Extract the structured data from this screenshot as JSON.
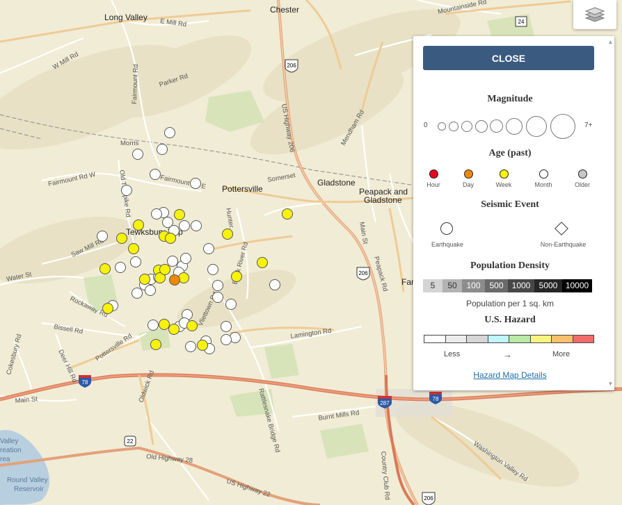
{
  "map": {
    "places": [
      {
        "name": "Long Valley",
        "big": true
      },
      {
        "name": "Chester",
        "big": true
      },
      {
        "name": "Pottersville",
        "big": true
      },
      {
        "name": "Gladstone",
        "big": true
      },
      {
        "name": "Peapack and",
        "big": true
      },
      {
        "name": "Gladstone",
        "big": true
      },
      {
        "name": "Tewksbury Twp",
        "big": true
      },
      {
        "name": "Far",
        "big": true
      }
    ],
    "roads": [
      "E Mill Rd",
      "W Mill Rd",
      "Parker Rd",
      "Fairmount Rd",
      "Fairmount Rd W",
      "Fairmount Rd E",
      "Old Turnpike Rd",
      "Saw Mill Rd",
      "Water St",
      "Rockaway Rd",
      "Bissell Rd",
      "Cokesbury Rd",
      "Deer Hill Rd",
      "Main St",
      "Pottersville Rd",
      "Lamington Rd",
      "Rattlesnake Bridge Rd",
      "Oldwick Rd",
      "Burnt Mills Rd",
      "Old Highway 28",
      "US Highway 22",
      "US Highway 206",
      "Mendham Rd",
      "Main St",
      "Peapack Rd",
      "Washington Valley Rd",
      "Country Club Rd",
      "Mountainside Rd",
      "Black River Rd",
      "Vliettown Rd",
      "Somerset",
      "Morris",
      "Hunter..."
    ],
    "shields": [
      "206",
      "206",
      "24",
      "78",
      "78",
      "287",
      "22",
      "206"
    ],
    "water": [
      "Valley",
      "reation",
      "rea",
      "Round Valley",
      "Reservoir"
    ]
  },
  "legend": {
    "close_label": "CLOSE",
    "magnitude": {
      "title": "Magnitude",
      "min_label": "0",
      "max_label": "7+"
    },
    "age": {
      "title": "Age (past)",
      "items": [
        {
          "label": "Hour",
          "color": "#e8001c"
        },
        {
          "label": "Day",
          "color": "#ee8a00"
        },
        {
          "label": "Week",
          "color": "#f7f20a"
        },
        {
          "label": "Month",
          "color": "#ffffff"
        },
        {
          "label": "Older",
          "color": "#c6c6c6"
        }
      ]
    },
    "seismic": {
      "title": "Seismic Event",
      "earthquake": "Earthquake",
      "non_earthquake": "Non-Earthquake"
    },
    "population": {
      "title": "Population Density",
      "values": [
        "5",
        "50",
        "100",
        "500",
        "1000",
        "5000",
        "10000"
      ],
      "caption": "Population per 1 sq. km"
    },
    "hazard": {
      "title": "U.S. Hazard",
      "colors": [
        "#ffffff",
        "#ececec",
        "#d6d6d6",
        "#bff5fb",
        "#b9e9a2",
        "#f8f57f",
        "#f7c06a",
        "#f26a6a"
      ],
      "less": "Less",
      "arrow": "→",
      "more": "More",
      "link": "Hazard Map Details"
    }
  },
  "earthquakes": [
    {
      "age": "month"
    },
    {
      "age": "month"
    },
    {
      "age": "month"
    },
    {
      "age": "month"
    },
    {
      "age": "month"
    },
    {
      "age": "month"
    },
    {
      "age": "month"
    },
    {
      "age": "month"
    },
    {
      "age": "month"
    },
    {
      "age": "month"
    },
    {
      "age": "month"
    },
    {
      "age": "month"
    },
    {
      "age": "month"
    },
    {
      "age": "month"
    },
    {
      "age": "month"
    },
    {
      "age": "month"
    },
    {
      "age": "month"
    },
    {
      "age": "month"
    },
    {
      "age": "month"
    },
    {
      "age": "month"
    },
    {
      "age": "month"
    },
    {
      "age": "month"
    },
    {
      "age": "month"
    },
    {
      "age": "month"
    },
    {
      "age": "month"
    },
    {
      "age": "month"
    },
    {
      "age": "month"
    },
    {
      "age": "month"
    },
    {
      "age": "month"
    },
    {
      "age": "month"
    },
    {
      "age": "month"
    },
    {
      "age": "month"
    },
    {
      "age": "month"
    },
    {
      "age": "month"
    },
    {
      "age": "month"
    },
    {
      "age": "month"
    },
    {
      "age": "month"
    },
    {
      "age": "month"
    },
    {
      "age": "month"
    },
    {
      "age": "month"
    },
    {
      "age": "month"
    },
    {
      "age": "week"
    },
    {
      "age": "week"
    },
    {
      "age": "week"
    },
    {
      "age": "week"
    },
    {
      "age": "week"
    },
    {
      "age": "week"
    },
    {
      "age": "week"
    },
    {
      "age": "week"
    },
    {
      "age": "week"
    },
    {
      "age": "week"
    },
    {
      "age": "week"
    },
    {
      "age": "week"
    },
    {
      "age": "week"
    },
    {
      "age": "week"
    },
    {
      "age": "week"
    },
    {
      "age": "week"
    },
    {
      "age": "week"
    },
    {
      "age": "week"
    },
    {
      "age": "week"
    },
    {
      "age": "week"
    },
    {
      "age": "week"
    },
    {
      "age": "week"
    },
    {
      "age": "day"
    }
  ]
}
